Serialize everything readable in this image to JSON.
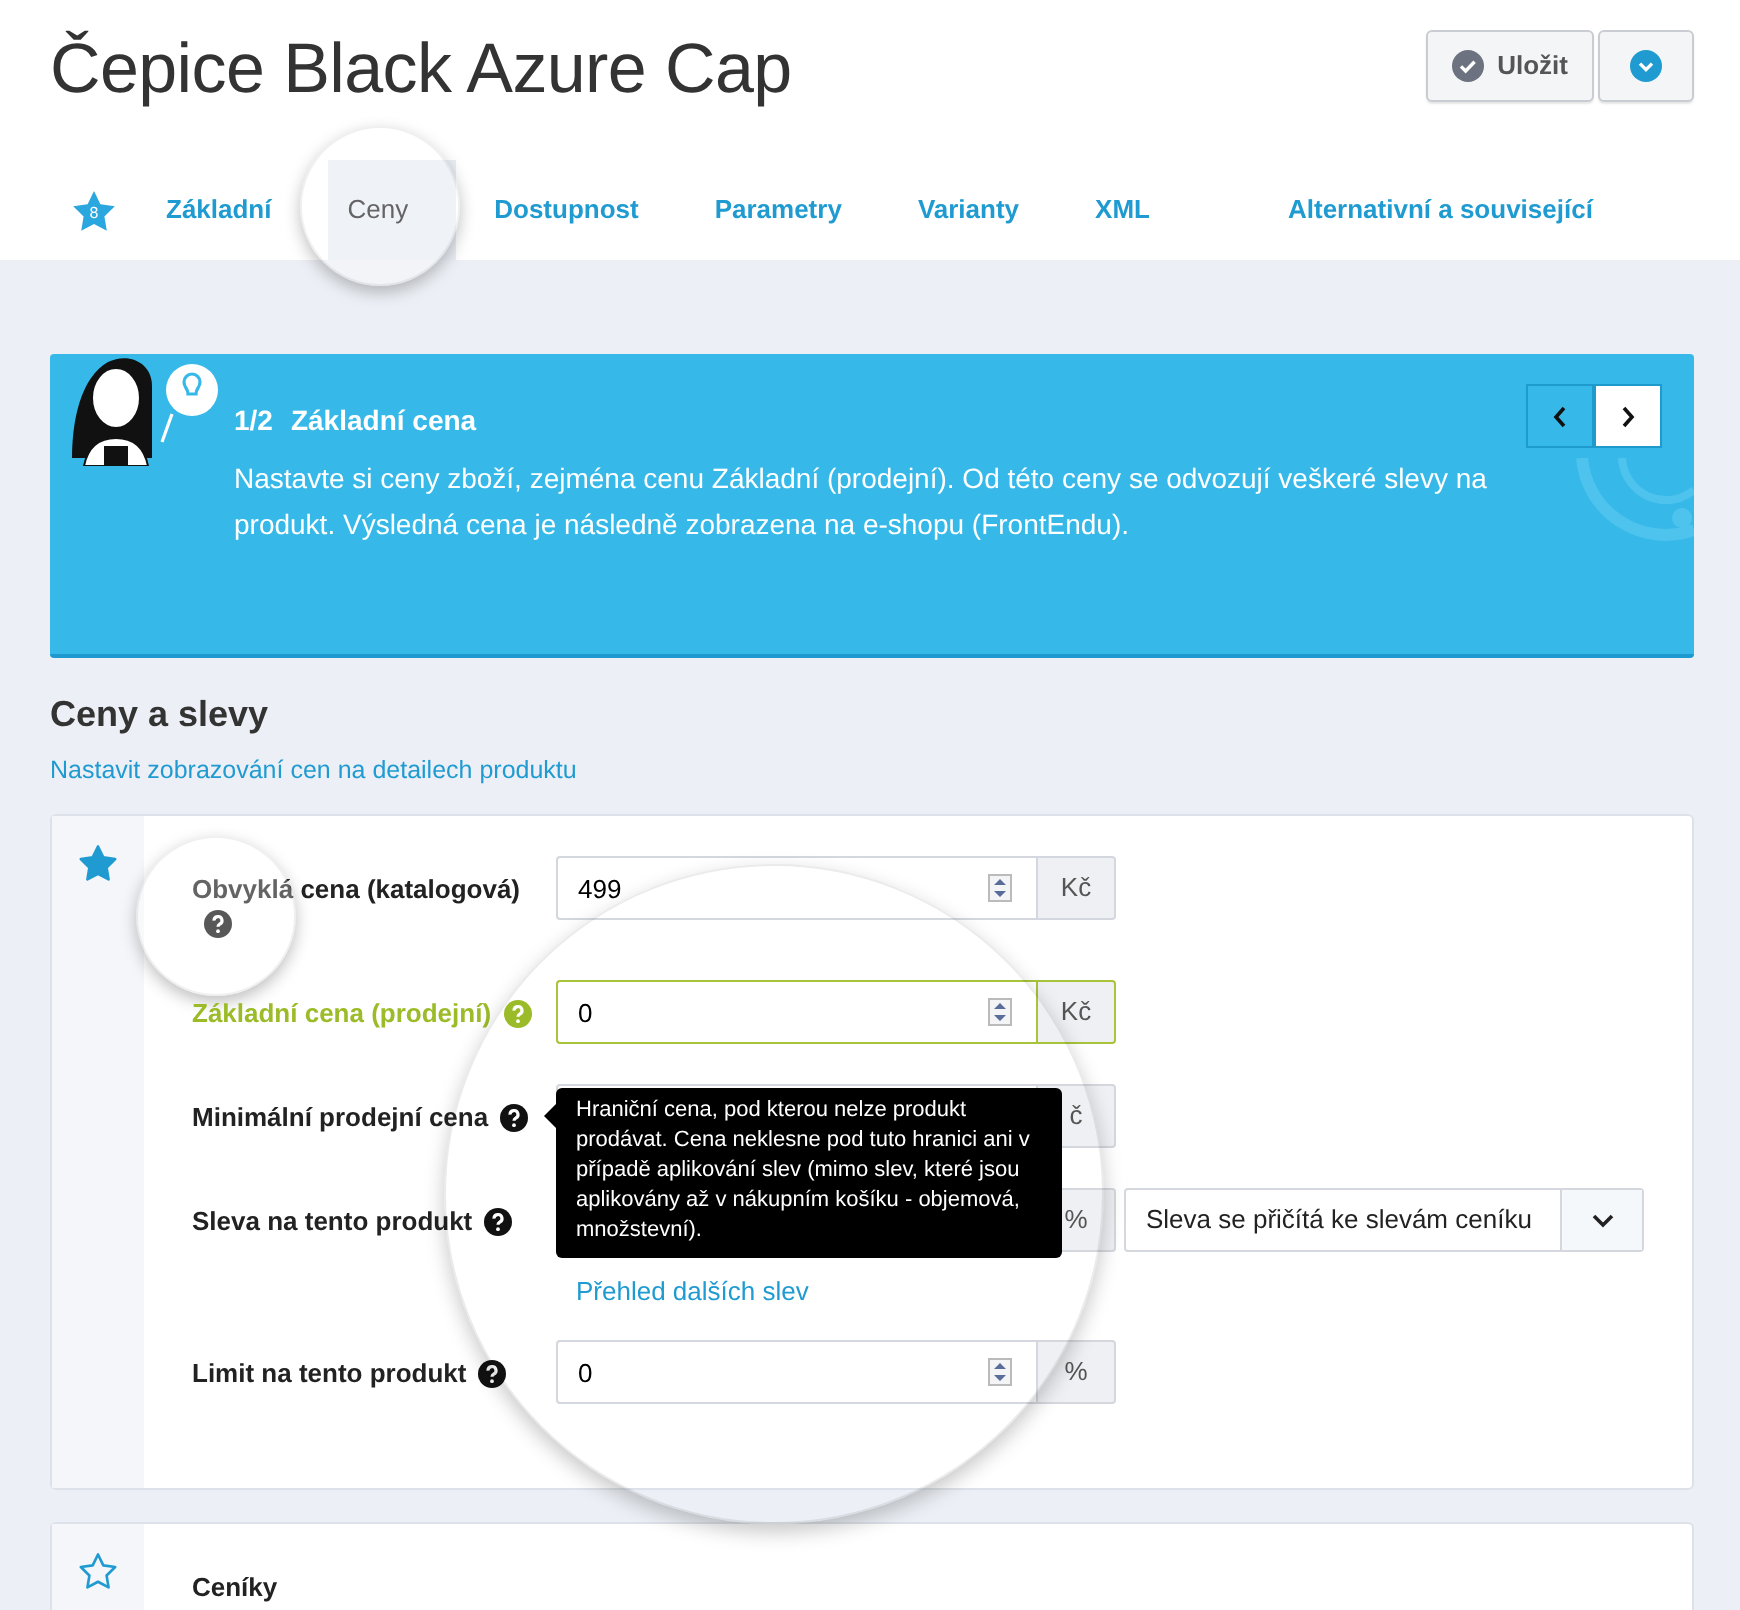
{
  "page_title": "Čepice Black Azure Cap",
  "header_buttons": {
    "save": "Uložit"
  },
  "tabs": [
    {
      "kind": "icon",
      "badge": "8",
      "selected": false,
      "spotlight": false
    },
    {
      "kind": "text",
      "label": "Základní",
      "selected": false,
      "spotlight": false
    },
    {
      "kind": "text",
      "label": "Ceny",
      "selected": true,
      "spotlight": true
    },
    {
      "kind": "text",
      "label": "Dostupnost",
      "selected": false,
      "spotlight": false
    },
    {
      "kind": "text",
      "label": "Parametry",
      "selected": false,
      "spotlight": false
    },
    {
      "kind": "text",
      "label": "Varianty",
      "selected": false,
      "spotlight": false
    },
    {
      "kind": "text",
      "label": "XML",
      "selected": false,
      "spotlight": false
    },
    {
      "kind": "text",
      "label": "Alternativní a související",
      "selected": false,
      "spotlight": false
    }
  ],
  "guide": {
    "step": "1/2",
    "title": "Základní cena",
    "text": "Nastavte si ceny zboží, zejména cenu Základní (prodejní). Od této ceny se odvozují veškeré slevy na produkt. Výsledná cena je následně zobrazena na e-shopu (FrontEndu)."
  },
  "section": {
    "title": "Ceny a slevy",
    "link": "Nastavit zobrazování cen na detailech produktu"
  },
  "price_card": {
    "starred": true,
    "lens": true,
    "fields": [
      {
        "kind": "number",
        "label": "Obvyklá cena (katalogová)",
        "value": "499",
        "unit": "Kč",
        "highlighted": false,
        "spotlight": true
      },
      {
        "kind": "number",
        "label": "Základní cena (prodejní)",
        "value": "0",
        "unit": "Kč",
        "highlighted": true,
        "spotlight": false
      },
      {
        "kind": "number",
        "label": "Minimální prodejní cena",
        "unit": "č",
        "highlighted": false,
        "spotlight": false,
        "tooltip": "Hraniční cena, pod kterou nelze produkt prodávat. Cena neklesne pod tuto hranici ani v případě aplikování slev (mimo slev, které jsou aplikovány až v nákupním košíku - objemová, množstevní)."
      },
      {
        "kind": "discount",
        "label": "Sleva na tento produkt",
        "unit": "%",
        "highlighted": false,
        "spotlight": false,
        "select": "Sleva se přičítá ke slevám ceníku",
        "link": "Přehled dalších slev"
      },
      {
        "kind": "number",
        "label": "Limit na tento produkt",
        "value": "0",
        "unit": "%",
        "highlighted": false,
        "spotlight": false
      }
    ]
  },
  "pricelists_card": {
    "starred": false,
    "title": "Ceníky"
  }
}
